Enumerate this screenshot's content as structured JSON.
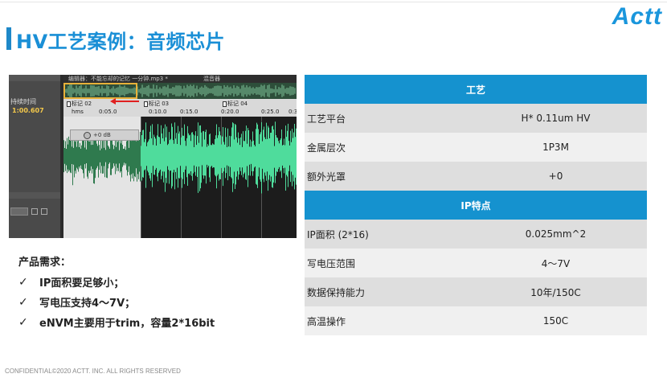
{
  "slide": {
    "title": "HV工艺案例：音频芯片",
    "logo": "Actt",
    "footer": "CONFIDENTIAL©2020 ACTT. INC. ALL RIGHTS RESERVED"
  },
  "editor": {
    "tab_label": "编辑器：不能忘却的记忆 一分钟.mp3 *",
    "tab2_label": "混音器",
    "side_label": "持续时间",
    "side_time": "1:00.607",
    "markers": [
      "标记 02",
      "标记 03",
      "标记 04"
    ],
    "ruler_ticks": [
      "0:05.0",
      "0:10.0",
      "0:15.0",
      "0:20.0",
      "0:25.0",
      "0:3"
    ],
    "ruler_start": "hms",
    "volume": "+0 dB",
    "colors": {
      "waveform": "#4fdc9c",
      "waveform_dark": "#2f7a4e",
      "selection": "#e4e4e4"
    }
  },
  "requirements": {
    "title": "产品需求：",
    "items": [
      "IP面积要足够小；",
      "写电压支持4～7V；",
      "eNVM主要用于trim，容量2*16bit"
    ],
    "check_icon": "✓"
  },
  "table": {
    "section1": "工艺",
    "rows1": [
      {
        "label": "工艺平台",
        "value": "H* 0.11um HV"
      },
      {
        "label": "金属层次",
        "value": "1P3M"
      },
      {
        "label": "额外光罩",
        "value": "+0"
      }
    ],
    "section2": "IP特点",
    "rows2": [
      {
        "label": "IP面积 (2*16)",
        "value": "0.025mm^2"
      },
      {
        "label": "写电压范围",
        "value": "4～7V"
      },
      {
        "label": "数据保持能力",
        "value": "10年/150C"
      },
      {
        "label": "高温操作",
        "value": "150C"
      }
    ],
    "colors": {
      "header": "#1592cf",
      "row_dark": "#dedede",
      "row_light": "#f0f0f0"
    }
  }
}
